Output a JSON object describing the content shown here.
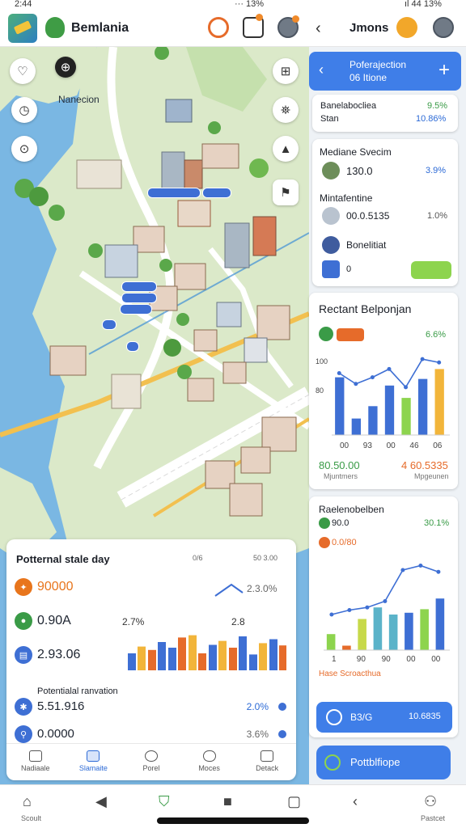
{
  "status_bar": {
    "time": "2:44",
    "right_left": "··· 13%",
    "right_right": "ıl 44 13%"
  },
  "app_bar": {
    "title": "Bemlania",
    "title_right": "Jmons",
    "icons": [
      "search-icon",
      "cart-icon",
      "avatar-icon",
      "chevron-left-icon",
      "notification-icon",
      "avatar-icon"
    ]
  },
  "map": {
    "label": "Nanecion",
    "left_controls": [
      "heart-icon",
      "timer-icon",
      "clock-icon"
    ],
    "right_controls": [
      "layers-icon",
      "route-icon",
      "cake-icon",
      "bookmark-icon"
    ],
    "colors": {
      "water": "#7ab7e3",
      "land": "#dbe9c9",
      "road": "#ffffff",
      "highway": "#f2c04f"
    }
  },
  "stats_card": {
    "title": "Potternal stale day",
    "header_1": "0/6",
    "header_2": "50 3.00",
    "mini_chart_pct": "2.3.0%",
    "mini_label_a": "2.7%",
    "mini_label_b": "2.8",
    "metrics": [
      {
        "value": "90000",
        "color": "#e8751c",
        "value_color": "#e8751c",
        "icon": "coin-icon"
      },
      {
        "value": "0.90A",
        "color": "#3a9b47",
        "value_color": "#2d3440",
        "icon": "leaf-icon"
      },
      {
        "value": "2.93.06",
        "color": "#3e6fd4",
        "value_color": "#2d3440",
        "icon": "chart-icon"
      }
    ],
    "bars": [
      {
        "a": 30,
        "b": 42,
        "ca": "#3e6fd4",
        "cb": "#f2b53a"
      },
      {
        "a": 36,
        "b": 50,
        "ca": "#e66b2a",
        "cb": "#3e6fd4"
      },
      {
        "a": 40,
        "b": 58,
        "ca": "#3e6fd4",
        "cb": "#e66b2a"
      },
      {
        "a": 62,
        "b": 30,
        "ca": "#f2b53a",
        "cb": "#e66b2a"
      },
      {
        "a": 45,
        "b": 52,
        "ca": "#3e6fd4",
        "cb": "#f2b53a"
      },
      {
        "a": 40,
        "b": 60,
        "ca": "#e66b2a",
        "cb": "#3e6fd4"
      },
      {
        "a": 28,
        "b": 48,
        "ca": "#3e6fd4",
        "cb": "#f2b53a"
      },
      {
        "a": 55,
        "b": 44,
        "ca": "#3e6fd4",
        "cb": "#e66b2a"
      }
    ],
    "sub_title": "Potentialal ranvation",
    "sub_rows": [
      {
        "value": "5.51.916",
        "pct": "2.0%",
        "icon": "person-icon",
        "color": "#3e6fd4",
        "pct_color": "#2c6ad6"
      },
      {
        "value": "0.0000",
        "pct": "3.6%",
        "icon": "bike-icon",
        "color": "#3e6fd4",
        "pct_color": "#666666"
      }
    ],
    "tabs": [
      {
        "label": "Nadiaale",
        "icon": "home-icon"
      },
      {
        "label": "Slamaite",
        "icon": "grid-icon"
      },
      {
        "label": "Porel",
        "icon": "heart-icon"
      },
      {
        "label": "Moces",
        "icon": "cloud-icon"
      },
      {
        "label": "Detack",
        "icon": "bag-icon"
      }
    ]
  },
  "right_panel": {
    "header": {
      "title_1": "Poferajection",
      "title_2": "06 Itione"
    },
    "card1": {
      "line_1": "Banelabocliea",
      "line_1_val": "9.5%",
      "line_2": "Stan",
      "line_2_val": "10.86%"
    },
    "list_items": [
      {
        "title": "Mediane Svecim",
        "sub": "",
        "value": "130.0",
        "pct": "3.9%",
        "icon": "person-icon"
      },
      {
        "title": "Mintafentine",
        "sub": "",
        "value": "00.0.5135",
        "pct": "1.0%",
        "icon": "bottle-icon"
      },
      {
        "title": "Bonelitiat",
        "sub": "0",
        "value": "",
        "pct": "",
        "icon": "person-icon"
      }
    ],
    "card2_button": "",
    "chart_card": {
      "title": "Rectant Belponjan",
      "tag": "",
      "pct": "6.6%",
      "yticks": [
        "100",
        "80"
      ],
      "xticks": [
        "00",
        "93",
        "00",
        "46",
        "06"
      ],
      "bars": [
        {
          "v": 70,
          "c": "#3e6fd4"
        },
        {
          "v": 20,
          "c": "#3e6fd4"
        },
        {
          "v": 35,
          "c": "#3e6fd4"
        },
        {
          "v": 60,
          "c": "#3e6fd4"
        },
        {
          "v": 45,
          "c": "#8dd44e"
        },
        {
          "v": 68,
          "c": "#3e6fd4"
        },
        {
          "v": 80,
          "c": "#f2b53a"
        }
      ],
      "line": [
        75,
        62,
        70,
        80,
        58,
        92,
        88
      ],
      "foot_left": "80.50.00",
      "foot_left_sub": "Mjuntmers",
      "foot_right": "4 60.5335",
      "foot_right_sub": "Mpgeunen"
    },
    "chart_card_2": {
      "title": "Raelenobelben",
      "row_1": "90.0",
      "row_1_pct": "30.1%",
      "row_2": "0.0/80",
      "bars": [
        {
          "v": 18,
          "c": "#8dd44e"
        },
        {
          "v": 5,
          "c": "#e66b2a"
        },
        {
          "v": 35,
          "c": "#c7d94a"
        },
        {
          "v": 48,
          "c": "#5bb3c9"
        },
        {
          "v": 40,
          "c": "#5bb3c9"
        },
        {
          "v": 42,
          "c": "#3e6fd4"
        },
        {
          "v": 46,
          "c": "#8dd44e"
        },
        {
          "v": 58,
          "c": "#3e6fd4"
        }
      ],
      "line": [
        40,
        45,
        48,
        55,
        90,
        95,
        88
      ],
      "xticks": [
        "1",
        "90",
        "90",
        "00",
        "00"
      ],
      "foot": "Hase Scroacthua"
    },
    "action": {
      "label": "B3/G",
      "value": "10.6835"
    },
    "action_2": {
      "label": "Pottblfiope"
    }
  },
  "sys_nav": {
    "items": [
      {
        "label": "Scoult",
        "icon": "home-icon"
      },
      {
        "label": "",
        "icon": "back-triangle-icon"
      },
      {
        "label": "",
        "icon": "shield-check-icon"
      },
      {
        "label": "",
        "icon": "square-icon"
      },
      {
        "label": "",
        "icon": "recents-icon"
      },
      {
        "label": "",
        "icon": "chevron-left-icon"
      },
      {
        "label": "Pastcet",
        "icon": "profile-icon"
      }
    ]
  }
}
